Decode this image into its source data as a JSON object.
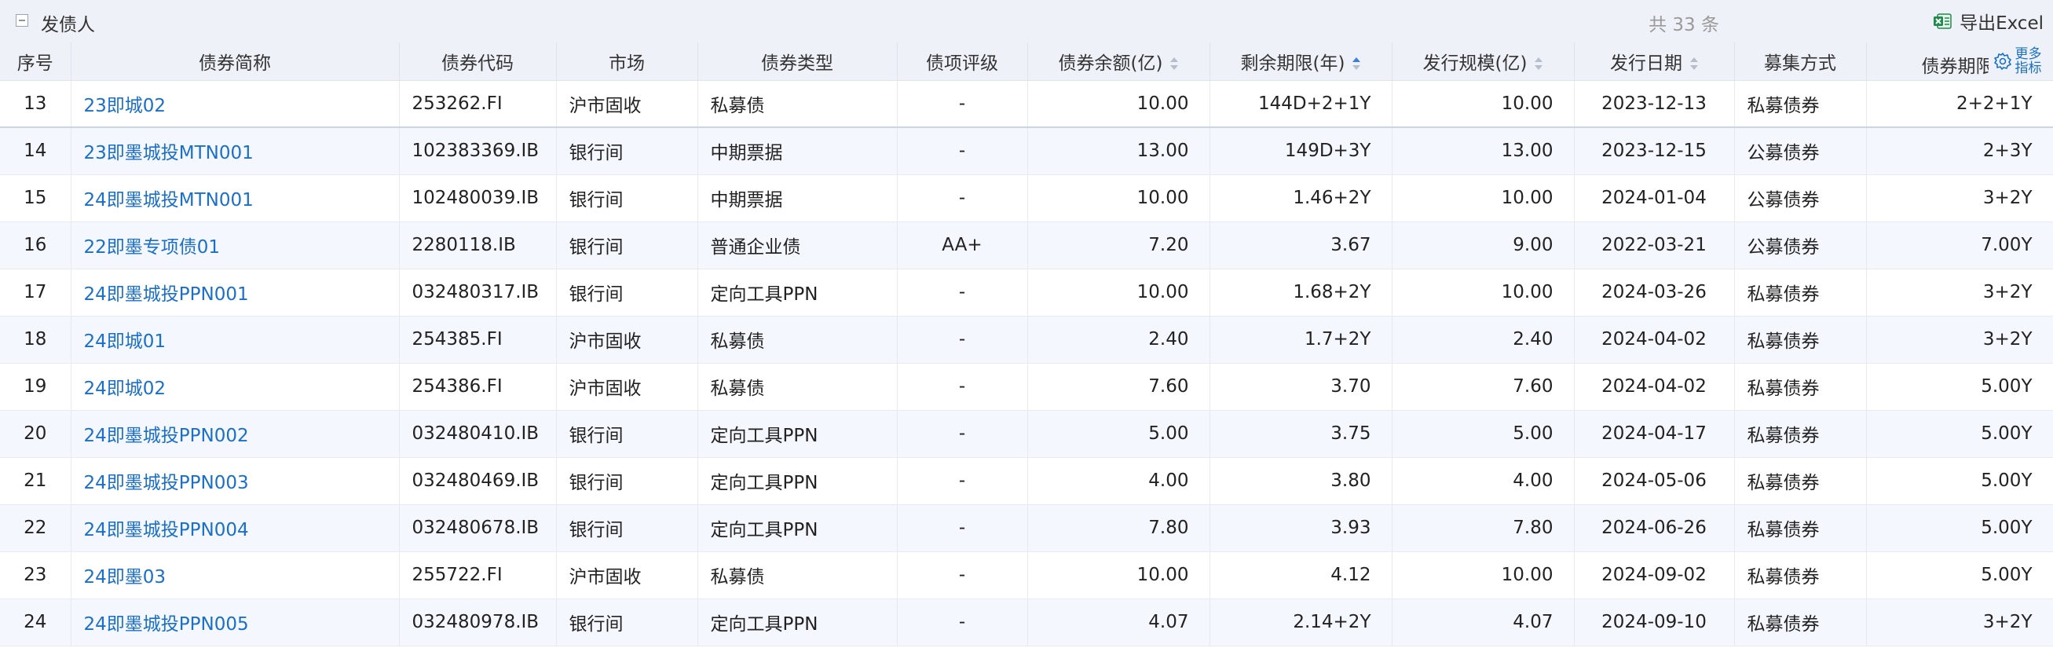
{
  "header": {
    "title": "发债人",
    "total": "共 33 条",
    "export_label": "导出Excel"
  },
  "columns": [
    {
      "label": "序号",
      "sort": "none"
    },
    {
      "label": "债券简称",
      "sort": "none"
    },
    {
      "label": "债券代码",
      "sort": "none"
    },
    {
      "label": "市场",
      "sort": "none"
    },
    {
      "label": "债券类型",
      "sort": "none"
    },
    {
      "label": "债项评级",
      "sort": "none"
    },
    {
      "label": "债券余额(亿)",
      "sort": "sortable"
    },
    {
      "label": "剩余期限(年)",
      "sort": "ascending"
    },
    {
      "label": "发行规模(亿)",
      "sort": "sortable"
    },
    {
      "label": "发行日期",
      "sort": "sortable"
    },
    {
      "label": "募集方式",
      "sort": "none"
    },
    {
      "label": "债券期限",
      "sort": "none"
    }
  ],
  "more_metrics": {
    "line1": "更多",
    "line2": "指标"
  },
  "rows": [
    {
      "no": "13",
      "name": "23即城02",
      "code": "253262.FI",
      "market": "沪市固收",
      "type": "私募债",
      "rating": "-",
      "balance": "10.00",
      "remaining": "144D+2+1Y",
      "size": "10.00",
      "date": "2023-12-13",
      "method": "私募债券",
      "term": "2+2+1Y"
    },
    {
      "no": "14",
      "name": "23即墨城投MTN001",
      "code": "102383369.IB",
      "market": "银行间",
      "type": "中期票据",
      "rating": "-",
      "balance": "13.00",
      "remaining": "149D+3Y",
      "size": "13.00",
      "date": "2023-12-15",
      "method": "公募债券",
      "term": "2+3Y"
    },
    {
      "no": "15",
      "name": "24即墨城投MTN001",
      "code": "102480039.IB",
      "market": "银行间",
      "type": "中期票据",
      "rating": "-",
      "balance": "10.00",
      "remaining": "1.46+2Y",
      "size": "10.00",
      "date": "2024-01-04",
      "method": "公募债券",
      "term": "3+2Y"
    },
    {
      "no": "16",
      "name": "22即墨专项债01",
      "code": "2280118.IB",
      "market": "银行间",
      "type": "普通企业债",
      "rating": "AA+",
      "balance": "7.20",
      "remaining": "3.67",
      "size": "9.00",
      "date": "2022-03-21",
      "method": "公募债券",
      "term": "7.00Y"
    },
    {
      "no": "17",
      "name": "24即墨城投PPN001",
      "code": "032480317.IB",
      "market": "银行间",
      "type": "定向工具PPN",
      "rating": "-",
      "balance": "10.00",
      "remaining": "1.68+2Y",
      "size": "10.00",
      "date": "2024-03-26",
      "method": "私募债券",
      "term": "3+2Y"
    },
    {
      "no": "18",
      "name": "24即城01",
      "code": "254385.FI",
      "market": "沪市固收",
      "type": "私募债",
      "rating": "-",
      "balance": "2.40",
      "remaining": "1.7+2Y",
      "size": "2.40",
      "date": "2024-04-02",
      "method": "私募债券",
      "term": "3+2Y"
    },
    {
      "no": "19",
      "name": "24即城02",
      "code": "254386.FI",
      "market": "沪市固收",
      "type": "私募债",
      "rating": "-",
      "balance": "7.60",
      "remaining": "3.70",
      "size": "7.60",
      "date": "2024-04-02",
      "method": "私募债券",
      "term": "5.00Y"
    },
    {
      "no": "20",
      "name": "24即墨城投PPN002",
      "code": "032480410.IB",
      "market": "银行间",
      "type": "定向工具PPN",
      "rating": "-",
      "balance": "5.00",
      "remaining": "3.75",
      "size": "5.00",
      "date": "2024-04-17",
      "method": "私募债券",
      "term": "5.00Y"
    },
    {
      "no": "21",
      "name": "24即墨城投PPN003",
      "code": "032480469.IB",
      "market": "银行间",
      "type": "定向工具PPN",
      "rating": "-",
      "balance": "4.00",
      "remaining": "3.80",
      "size": "4.00",
      "date": "2024-05-06",
      "method": "私募债券",
      "term": "5.00Y"
    },
    {
      "no": "22",
      "name": "24即墨城投PPN004",
      "code": "032480678.IB",
      "market": "银行间",
      "type": "定向工具PPN",
      "rating": "-",
      "balance": "7.80",
      "remaining": "3.93",
      "size": "7.80",
      "date": "2024-06-26",
      "method": "私募债券",
      "term": "5.00Y"
    },
    {
      "no": "23",
      "name": "24即墨03",
      "code": "255722.FI",
      "market": "沪市固收",
      "type": "私募债",
      "rating": "-",
      "balance": "10.00",
      "remaining": "4.12",
      "size": "10.00",
      "date": "2024-09-02",
      "method": "私募债券",
      "term": "5.00Y"
    },
    {
      "no": "24",
      "name": "24即墨城投PPN005",
      "code": "032480978.IB",
      "market": "银行间",
      "type": "定向工具PPN",
      "rating": "-",
      "balance": "4.07",
      "remaining": "2.14+2Y",
      "size": "4.07",
      "date": "2024-09-10",
      "method": "私募债券",
      "term": "3+2Y"
    }
  ],
  "colors": {
    "link": "#1a6fc9",
    "header_bg": "#eef2f8",
    "alt_row": "#f4f7fd",
    "sort_active": "#3a7de0"
  },
  "icons": {
    "collapse": "minus-square-icon",
    "export": "excel-icon",
    "more": "gear-icon"
  }
}
